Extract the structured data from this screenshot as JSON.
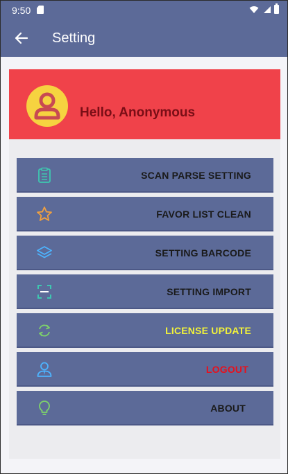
{
  "status_bar": {
    "time": "9:50"
  },
  "app_bar": {
    "title": "Setting"
  },
  "profile": {
    "greeting": "Hello, Anonymous"
  },
  "menu": [
    {
      "label": "SCAN PARSE SETTING",
      "icon": "clipboard-icon",
      "color": "#1a1a1a"
    },
    {
      "label": "FAVOR LIST CLEAN",
      "icon": "star-icon",
      "color": "#1a1a1a"
    },
    {
      "label": "SETTING BARCODE",
      "icon": "layers-icon",
      "color": "#1a1a1a"
    },
    {
      "label": "SETTING IMPORT",
      "icon": "scan-frame-icon",
      "color": "#1a1a1a"
    },
    {
      "label": "LICENSE UPDATE",
      "icon": "refresh-icon",
      "color": "#f2f23a"
    },
    {
      "label": "LOGOUT",
      "icon": "user-icon",
      "color": "#e8101c"
    },
    {
      "label": "ABOUT",
      "icon": "lightbulb-icon",
      "color": "#1a1a1a"
    }
  ],
  "colors": {
    "primary": "#5c6a98",
    "profile_bg": "#f0424a",
    "avatar": "#f6d340"
  }
}
